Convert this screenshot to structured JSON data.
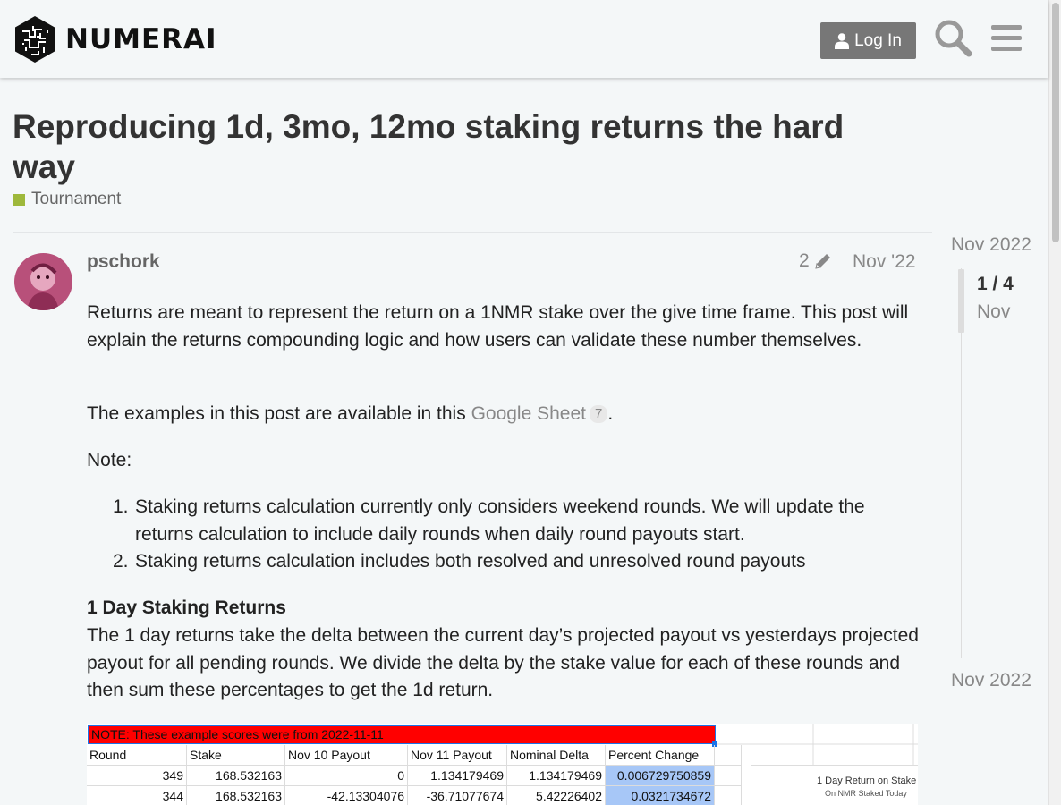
{
  "header": {
    "brand": "NUMERAI",
    "login_label": "Log In",
    "icons": {
      "login": "user-icon",
      "search": "search-icon",
      "menu": "hamburger-menu-icon"
    }
  },
  "topic": {
    "title": "Reproducing 1d, 3mo, 12mo staking returns the hard way",
    "category": "Tournament",
    "category_color": "#9eb83b"
  },
  "post": {
    "username": "pschork",
    "edit_count": "2",
    "date": "Nov '22",
    "para1": "Returns are meant to represent the return on a 1NMR stake over the give time frame. This post will",
    "para1b": "explain the returns compounding logic and how users can validate these number themselves.",
    "para2_pre": "The examples in this post are available in this ",
    "link_text": "Google Sheet",
    "link_clicks": "7",
    "para2_post": ".",
    "note_label": "Note:",
    "notes": [
      {
        "num": "1.",
        "text": "Staking returns calculation currently only considers weekend rounds. We will update the returns calculation to include daily rounds when daily round payouts start."
      },
      {
        "num": "2.",
        "text": "Staking returns calculation includes both resolved and unresolved round payouts"
      }
    ],
    "section_heading": "1 Day Staking Returns",
    "para3": "The 1 day returns take the delta between the current day’s projected payout vs yesterdays projected payout for all pending rounds. We divide the delta by the stake value for each of these rounds and then sum these percentages to get the 1d return."
  },
  "sheet": {
    "note": "NOTE: These example scores were from 2022-11-11",
    "headers": [
      "Round",
      "Stake",
      "Nov 10 Payout",
      "Nov 11 Payout",
      "Nominal Delta",
      "Percent Change"
    ],
    "rows": [
      [
        "349",
        "168.532163",
        "0",
        "1.134179469",
        "1.134179469",
        "0.006729750859"
      ],
      [
        "344",
        "168.532163",
        "-42.13304076",
        "-36.71077674",
        "5.42226402",
        "0.0321734672"
      ]
    ],
    "chart_title": "1 Day Return on Stake",
    "chart_subtitle": "On NMR Staked Today"
  },
  "timeline": {
    "start": "Nov 2022",
    "position": "1 / 4",
    "position_date": "Nov",
    "end": "Nov 2022"
  }
}
